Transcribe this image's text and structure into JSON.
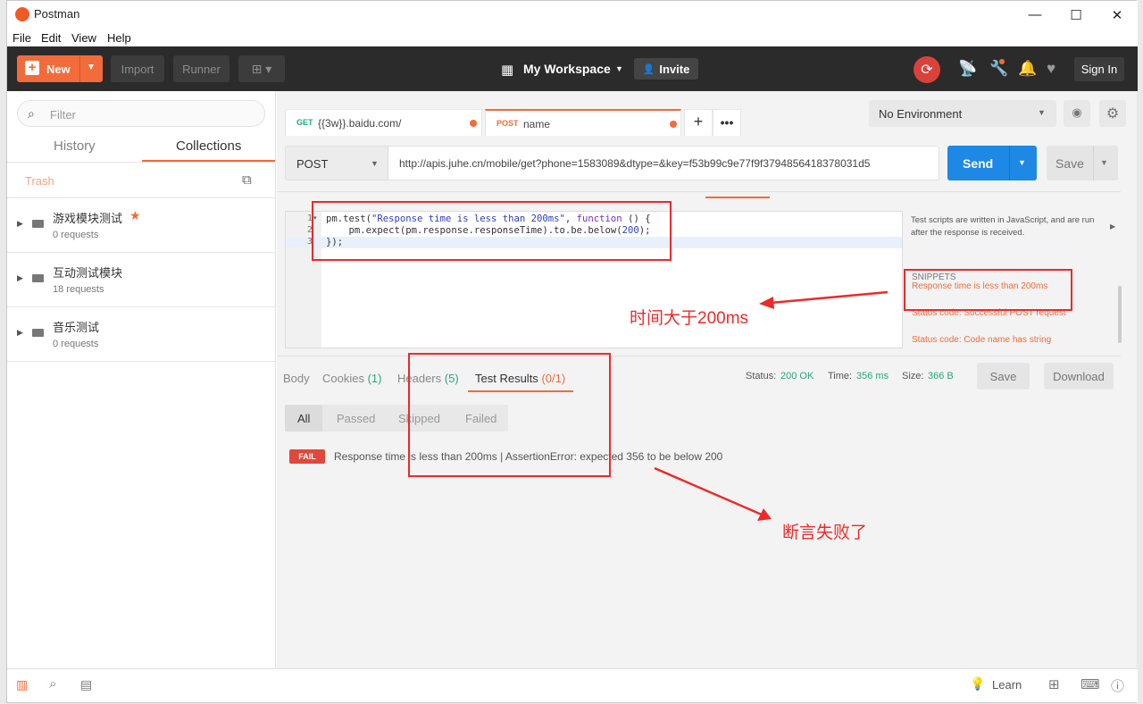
{
  "window": {
    "title": "Postman",
    "minimize": "—",
    "maximize": "☐",
    "close": "✕"
  },
  "menu": [
    "File",
    "Edit",
    "View",
    "Help"
  ],
  "header": {
    "new_label": "New",
    "import_label": "Import",
    "runner_label": "Runner",
    "workspace_label": "My Workspace",
    "invite_label": "Invite",
    "signin_label": "Sign In"
  },
  "sidebar": {
    "filter_placeholder": "Filter",
    "tabs": [
      "History",
      "Collections"
    ],
    "trash_label": "Trash",
    "collections": [
      {
        "name": "游戏模块测试",
        "count": "0 requests",
        "starred": true
      },
      {
        "name": "互动测试模块",
        "count": "18 requests",
        "starred": false
      },
      {
        "name": "音乐测试",
        "count": "0 requests",
        "starred": false
      }
    ]
  },
  "tabs": [
    {
      "method": "GET",
      "url": "{{3w}}.baidu.com/"
    },
    {
      "method": "POST",
      "url": "name"
    }
  ],
  "environment": {
    "selected": "No Environment"
  },
  "request": {
    "method": "POST",
    "url": "http://apis.juhe.cn/mobile/get?phone=1583089&dtype=&key=f53b99c9e77f9f3794856418378031d5",
    "send_label": "Send",
    "save_label": "Save"
  },
  "editor": {
    "line_numbers": [
      "1",
      "2",
      "3"
    ],
    "lines": [
      {
        "a": "pm.test(",
        "b": "\"Response time is less than 200ms\"",
        "c": ", ",
        "d": "function",
        "e": " () {"
      },
      {
        "a": "    pm.expect(pm.response.responseTime).to.be.below(",
        "b": "200",
        "c": ");"
      },
      {
        "a": "});"
      }
    ]
  },
  "snippets": {
    "description": "Test scripts are written in JavaScript, and are run after the response is received.",
    "heading": "SNIPPETS",
    "items": [
      "Response time is less than 200ms",
      "Status code: Successful POST request",
      "Status code: Code name has string"
    ]
  },
  "annotations": {
    "time_label": "时间大于200ms",
    "assert_label": "断言失败了"
  },
  "response": {
    "tabs": {
      "body": "Body",
      "cookies": "Cookies",
      "cookies_count": "(1)",
      "headers": "Headers",
      "headers_count": "(5)",
      "tests": "Test Results",
      "tests_count": "(0/1)"
    },
    "status_label": "Status:",
    "status_value": "200 OK",
    "time_label": "Time:",
    "time_value": "356 ms",
    "size_label": "Size:",
    "size_value": "366 B",
    "save_label": "Save",
    "download_label": "Download"
  },
  "test_filters": [
    "All",
    "Passed",
    "Skipped",
    "Failed"
  ],
  "test_result": {
    "badge": "FAIL",
    "text": "Response time is less than 200ms | AssertionError: expected 356 to be below 200"
  },
  "statusbar": {
    "learn_label": "Learn"
  },
  "colors": {
    "accent": "#f26b3a",
    "send": "#1e88e5",
    "annotation": "#ec2a2a",
    "success": "#27a87a"
  }
}
